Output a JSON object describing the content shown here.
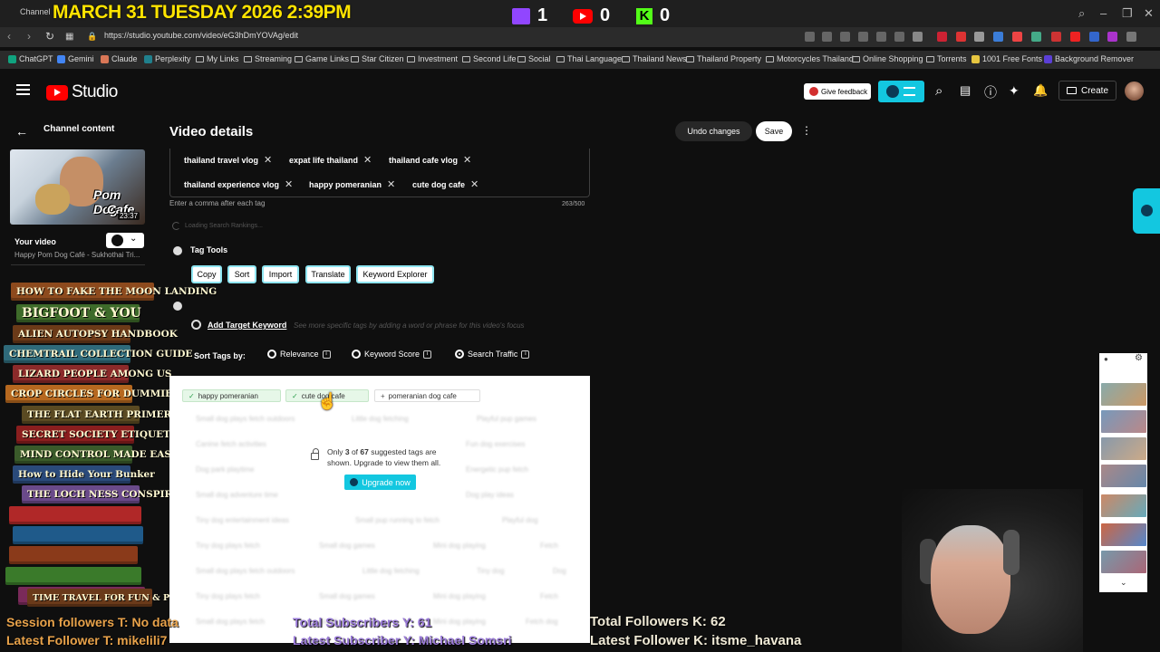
{
  "overlay": {
    "date_time": "MARCH 31 TUESDAY 2026 2:39PM",
    "twitch_count": "1",
    "youtube_count": "0",
    "kick_count": "0",
    "session_followers": "Session followers T: No data",
    "latest_follower_t": "Latest Follower T: mikelili7",
    "total_subscribers": "Total Subscribers Y: 61",
    "latest_subscriber": "Latest Subscriber Y: Michael Somsri",
    "total_followers_k": "Total Followers K: 62",
    "latest_follower_k": "Latest Follower K: itsme_havana"
  },
  "browser": {
    "tab_label": "Channel",
    "url": "https://studio.youtube.com/video/eG3hDmYOVAg/edit"
  },
  "bookmarks": [
    "ChatGPT",
    "Gemini",
    "Claude",
    "Perplexity",
    "My Links",
    "Streaming",
    "Game Links",
    "Star Citizen",
    "Investment",
    "Second Life",
    "Social",
    "Thai Language",
    "Thailand News",
    "Thailand Property",
    "Motorcycles Thailand",
    "Online Shopping",
    "Torrents",
    "1001 Free Fonts",
    "Background Remover"
  ],
  "header": {
    "logo_text": "Studio",
    "feedback_label": "Give feedback",
    "create_label": "Create"
  },
  "sidebar": {
    "back_label": "Channel content",
    "thumb_title_1": "Pom Dog",
    "thumb_title_2": "Cafe",
    "duration": "23:37",
    "your_video": "Your video",
    "video_title": "Happy Pom Dog Café - Sukhothai Tri..."
  },
  "books": [
    "HOW TO FAKE THE MOON LANDING",
    "BIGFOOT & YOU",
    "ALIEN AUTOPSY HANDBOOK",
    "CHEMTRAIL COLLECTION GUIDE",
    "LIZARD PEOPLE AMONG US",
    "CROP CIRCLES FOR DUMMIES",
    "THE FLAT EARTH PRIMER",
    "SECRET SOCIETY ETIQUETTE",
    "MIND CONTROL MADE EASY",
    "How to Hide Your Bunker",
    "THE LOCH NESS CONSPIRACY",
    "",
    "",
    "",
    "",
    "",
    "TIME TRAVEL FOR FUN & PROFIT"
  ],
  "main": {
    "title": "Video details",
    "undo_label": "Undo changes",
    "save_label": "Save",
    "tags": [
      "thailand travel vlog",
      "expat life thailand",
      "thailand cafe vlog",
      "thailand experience vlog",
      "happy pomeranian",
      "cute dog cafe"
    ],
    "tags_hint": "Enter a comma after each tag",
    "tags_count": "263/500",
    "loading_text": "Loading Search Rankings...",
    "tag_tools_title": "Tag Tools",
    "tools": [
      "Copy",
      "Sort",
      "Import",
      "Translate",
      "Keyword Explorer"
    ],
    "add_target": "Add Target Keyword",
    "target_hint": "See more specific tags by adding a word or phrase for this video's focus",
    "sort_label": "Sort Tags by:",
    "sort_options": [
      "Relevance",
      "Keyword Score",
      "Search Traffic"
    ],
    "sort_selected": "Search Traffic",
    "chips": [
      "happy pomeranian",
      "cute dog cafe",
      "pomeranian dog cafe"
    ],
    "blurred": [
      "Small dog plays fetch outdoors",
      "Little dog fetching",
      "Playful pup games",
      "Canine fetch activities",
      "Fun dog exercises",
      "Dog park playtime",
      "Energetic pup fetch",
      "Small dog adventure time",
      "Dog play ideas",
      "Tiny dog entertainment ideas",
      "Small pup running to fetch",
      "Playful dog",
      "Tiny dog plays fetch",
      "Small dog games",
      "Mini dog playing",
      "Fetch",
      "Small dog plays fetch outdoors",
      "Little dog fetching",
      "Tiny dog",
      "Dog",
      "Tiny dog plays fetch",
      "Small dog games",
      "Mini dog playing",
      "Fetch",
      "Small dog plays fetch",
      "Small pup",
      "Mini dog playing",
      "Fetch dog"
    ],
    "upgrade_pre": "Only ",
    "upgrade_shown": "3",
    "upgrade_of": " of ",
    "upgrade_total": "67",
    "upgrade_post": " suggested tags are shown. Upgrade to view them all.",
    "upgrade_btn": "Upgrade now"
  }
}
